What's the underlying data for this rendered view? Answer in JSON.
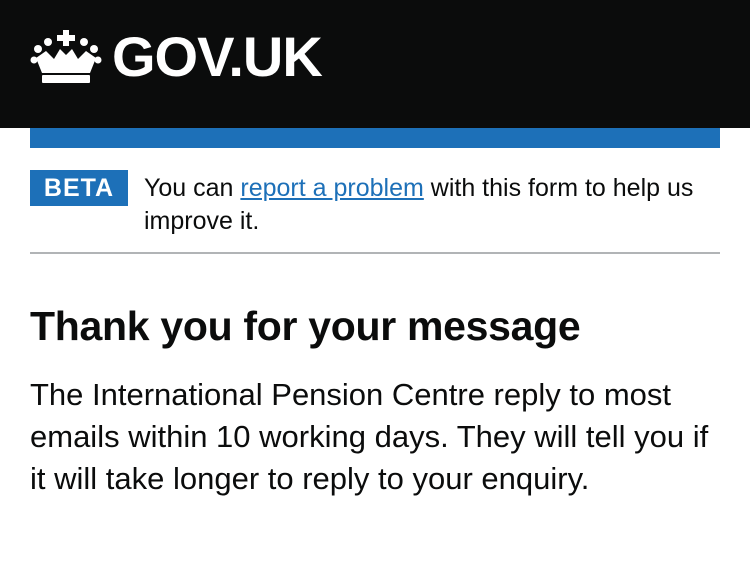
{
  "header": {
    "logo_text": "GOV.UK",
    "logo_icon": "crown-icon"
  },
  "phase_banner": {
    "tag": "BETA",
    "text_before": "You can ",
    "link_text": "report a problem",
    "text_after": " with this form to help us improve it."
  },
  "main": {
    "title": "Thank you for your message",
    "body": "The International Pension Centre reply to most emails within 10 working days. They will tell you if it will take longer to reply to your enquiry."
  },
  "colors": {
    "header_bg": "#0b0c0c",
    "brand_blue": "#1d70b8",
    "text": "#0b0c0c",
    "border": "#b1b4b6"
  }
}
